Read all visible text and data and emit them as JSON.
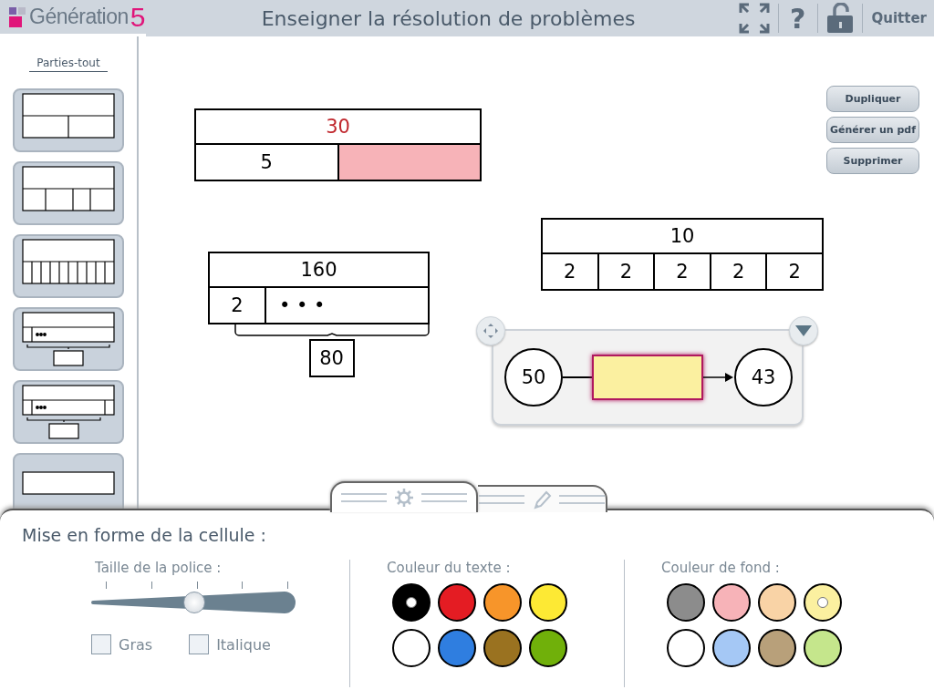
{
  "header": {
    "logo_text": "Génération",
    "logo_number": "5",
    "title": "Enseigner la résolution de problèmes",
    "help_label": "?",
    "quit_label": "Quitter"
  },
  "sidebar": {
    "title": "Parties-tout",
    "templates": [
      {
        "kind": "two-parts"
      },
      {
        "kind": "four-parts"
      },
      {
        "kind": "ten-parts"
      },
      {
        "kind": "brace"
      },
      {
        "kind": "brace-end"
      },
      {
        "kind": "single"
      }
    ]
  },
  "actions": [
    "Dupliquer",
    "Générer un pdf",
    "Supprimer"
  ],
  "diagrams": [
    {
      "kind": "bar",
      "whole": {
        "text": "30",
        "color": "#c0272d"
      },
      "parts": [
        {
          "kind": "value",
          "text": "5",
          "color": "#ffffff"
        },
        {
          "kind": "value",
          "color": "#f7b3b8"
        }
      ]
    },
    {
      "kind": "bar",
      "whole": {
        "text": "10",
        "color": "#000000"
      },
      "parts": [
        {
          "kind": "value",
          "text": "2",
          "color": "#ffffff"
        },
        {
          "kind": "value",
          "text": "2",
          "color": "#ffffff"
        },
        {
          "kind": "value",
          "text": "2",
          "color": "#ffffff"
        },
        {
          "kind": "value",
          "text": "2",
          "color": "#ffffff"
        },
        {
          "kind": "value",
          "text": "2",
          "color": "#ffffff"
        }
      ]
    },
    {
      "kind": "bar",
      "whole": {
        "text": "160",
        "color": "#000000"
      },
      "parts": [
        {
          "kind": "value",
          "text": "2",
          "color": "#ffffff"
        },
        {
          "kind": "ellipsis",
          "text": "• • •",
          "color": "#ffffff"
        }
      ],
      "brace_total": "80"
    },
    {
      "kind": "arrow",
      "start": "50",
      "operation": {
        "color": "#fbf0a0",
        "selected": true
      },
      "end": "43"
    }
  ],
  "panel": {
    "tabs": [
      {
        "kind": "settings",
        "selected": true
      },
      {
        "kind": "edit",
        "selected": false
      }
    ],
    "title": "Mise en forme de la cellule :",
    "font_size": {
      "label": "Taille de la police :",
      "level": 0.5
    },
    "options": [
      {
        "label": "Gras",
        "checked": false
      },
      {
        "label": "Italique",
        "checked": false
      }
    ],
    "text_color": {
      "label": "Couleur du texte :",
      "swatches": [
        {
          "color": "#000000",
          "selected": true
        },
        {
          "color": "#e41c23",
          "selected": false
        },
        {
          "color": "#f7952a",
          "selected": false
        },
        {
          "color": "#fde934",
          "selected": false
        },
        {
          "color": "#ffffff",
          "selected": false
        },
        {
          "color": "#2f7ee0",
          "selected": false
        },
        {
          "color": "#9a7220",
          "selected": false
        },
        {
          "color": "#70b00a",
          "selected": false
        }
      ]
    },
    "background_color": {
      "label": "Couleur de fond :",
      "swatches": [
        {
          "color": "#8c8c8c",
          "selected": false
        },
        {
          "color": "#f7b3b8",
          "selected": false
        },
        {
          "color": "#f9d3a6",
          "selected": false
        },
        {
          "color": "#fbf0a0",
          "selected": true
        },
        {
          "color": "#ffffff",
          "selected": false
        },
        {
          "color": "#a5c8f5",
          "selected": false
        },
        {
          "color": "#b8a07a",
          "selected": false
        },
        {
          "color": "#c5e68c",
          "selected": false
        }
      ]
    }
  }
}
